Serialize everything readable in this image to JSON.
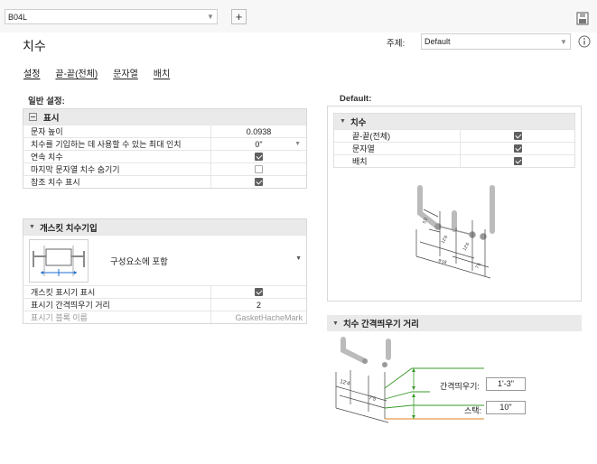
{
  "topbar": {
    "style_value": "B04L",
    "add_label": "+"
  },
  "header": {
    "title": "치수",
    "theme_label": "주제:",
    "theme_value": "Default"
  },
  "tabs": [
    "설정",
    "끝-끝(전체)",
    "문자열",
    "배치"
  ],
  "general": {
    "label": "일반 설정:",
    "display": {
      "header": "표시",
      "rows": [
        {
          "label": "문자 높이",
          "value": "0.0938",
          "kind": "text"
        },
        {
          "label": "치수를 기입하는 데 사용할 수 있는 최대 인치",
          "value": "0\"",
          "kind": "dropdown"
        },
        {
          "label": "연속 치수",
          "checked": true,
          "kind": "check"
        },
        {
          "label": "마지막 문자열 치수 숨기기",
          "checked": false,
          "kind": "check"
        },
        {
          "label": "참조 치수 표시",
          "checked": true,
          "kind": "check"
        }
      ]
    },
    "gasket": {
      "header": "개스킷 치수기입",
      "dropdown_value": "구성요소에 포함",
      "rows": [
        {
          "label": "개스킷 표시기 표시",
          "checked": true,
          "kind": "check"
        },
        {
          "label": "표시기 간격띄우기 거리",
          "value": "2",
          "kind": "text"
        },
        {
          "label": "표시기 블록 이름",
          "value": "GasketHacheMark",
          "kind": "grey"
        }
      ]
    }
  },
  "defaults": {
    "label": "Default:",
    "header": "치수",
    "rows": [
      {
        "label": "끝-끝(전체)",
        "checked": true
      },
      {
        "label": "문자열",
        "checked": true
      },
      {
        "label": "배치",
        "checked": true
      }
    ]
  },
  "offset": {
    "header": "치수 간격띄우기 거리",
    "offset_label": "간격띄우기:",
    "offset_value": "1'-3\"",
    "stack_label": "스택:",
    "stack_value": "10\""
  },
  "colors": {
    "green": "#3a9a2a",
    "orange": "#e08020",
    "blue": "#1e6fd0"
  }
}
